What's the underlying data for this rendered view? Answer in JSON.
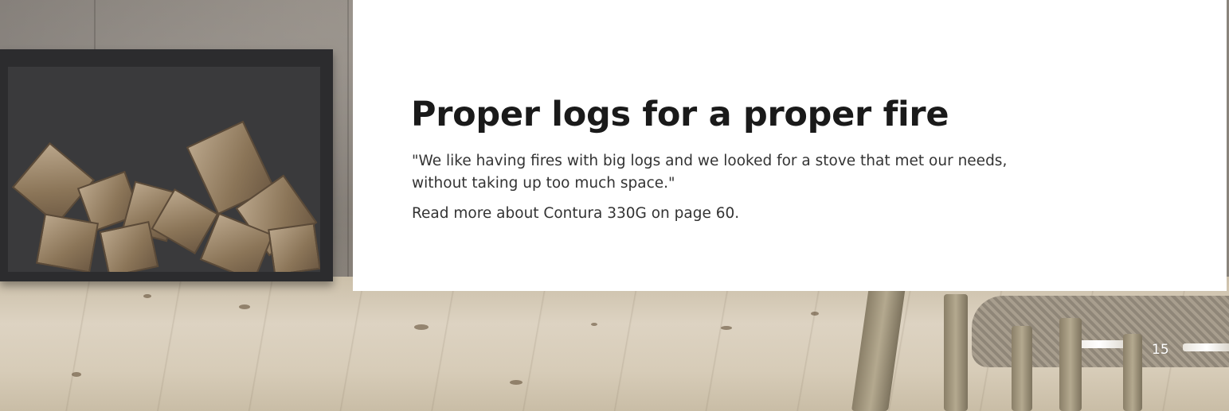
{
  "article": {
    "headline": "Proper logs for a proper fire",
    "quote": "\"We like having fires with big logs and we looked for a stove that met our needs, without taking up too much space.\"",
    "read_more": "Read more about Contura 330G on page 60."
  },
  "page": {
    "number": "15"
  },
  "colors": {
    "panel_background": "#ffffff",
    "headline_text": "#1a1a1a",
    "body_text": "#333333",
    "page_number": "#ffffff"
  },
  "photo": {
    "subject": "log-holder-with-firewood-and-chair"
  }
}
